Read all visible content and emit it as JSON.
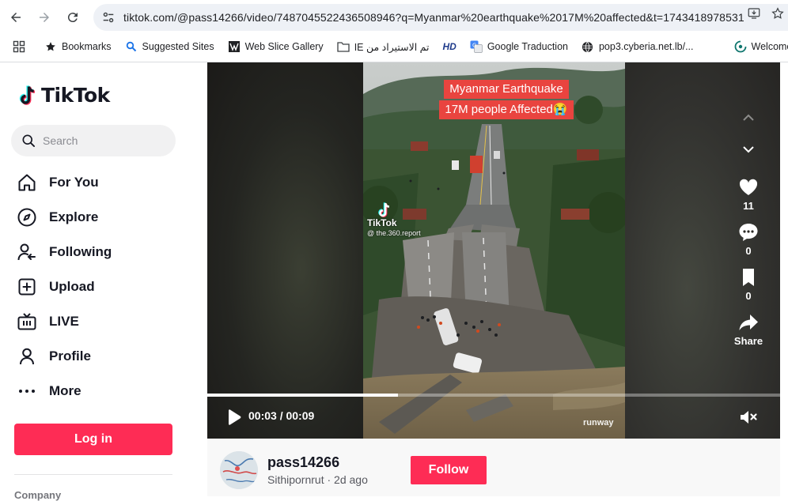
{
  "browser": {
    "url": "tiktok.com/@pass14266/video/7487045522436508946?q=Myanmar%20earthquake%2017M%20affected&t=1743418978531",
    "bookmarks": [
      {
        "label": "Bookmarks",
        "icon": "star-icon"
      },
      {
        "label": "Suggested Sites",
        "icon": "bing-icon"
      },
      {
        "label": "Web Slice Gallery",
        "icon": "web-slice-icon"
      },
      {
        "label": "تم الاستيراد من IE",
        "icon": "folder-icon"
      },
      {
        "label": "",
        "icon": "hd-icon"
      },
      {
        "label": "Google Traduction",
        "icon": "google-translate-icon"
      },
      {
        "label": "pop3.cyberia.net.lb/...",
        "icon": "globe-icon"
      },
      {
        "label": "Welcome to RA",
        "icon": "welcome-icon"
      }
    ],
    "hd_label": "HD"
  },
  "sidebar": {
    "logo_text": "TikTok",
    "search_placeholder": "Search",
    "nav": [
      {
        "label": "For You",
        "icon": "home-icon"
      },
      {
        "label": "Explore",
        "icon": "compass-icon"
      },
      {
        "label": "Following",
        "icon": "following-icon"
      },
      {
        "label": "Upload",
        "icon": "upload-icon"
      },
      {
        "label": "LIVE",
        "icon": "live-icon"
      },
      {
        "label": "Profile",
        "icon": "profile-icon"
      },
      {
        "label": "More",
        "icon": "more-icon"
      }
    ],
    "login_label": "Log in",
    "company_label": "Company"
  },
  "video": {
    "caption_line1": "Myanmar Earthquake",
    "caption_line2": "17M people Affected😭",
    "watermark_name": "TikTok",
    "watermark_handle": "@ the.360.report",
    "overlay_brand": "runway",
    "time": "00:03 / 00:09",
    "progress": 0.333,
    "likes": "11",
    "comments": "0",
    "saves": "0",
    "share_label": "Share"
  },
  "author": {
    "username": "pass14266",
    "display_name": "Sithipornrut",
    "posted": "2d ago",
    "separator": " · ",
    "follow_label": "Follow"
  },
  "colors": {
    "accent": "#fe2c55",
    "caption_bg": "#e9443f",
    "tiktok_cyan": "#25f4ee"
  }
}
